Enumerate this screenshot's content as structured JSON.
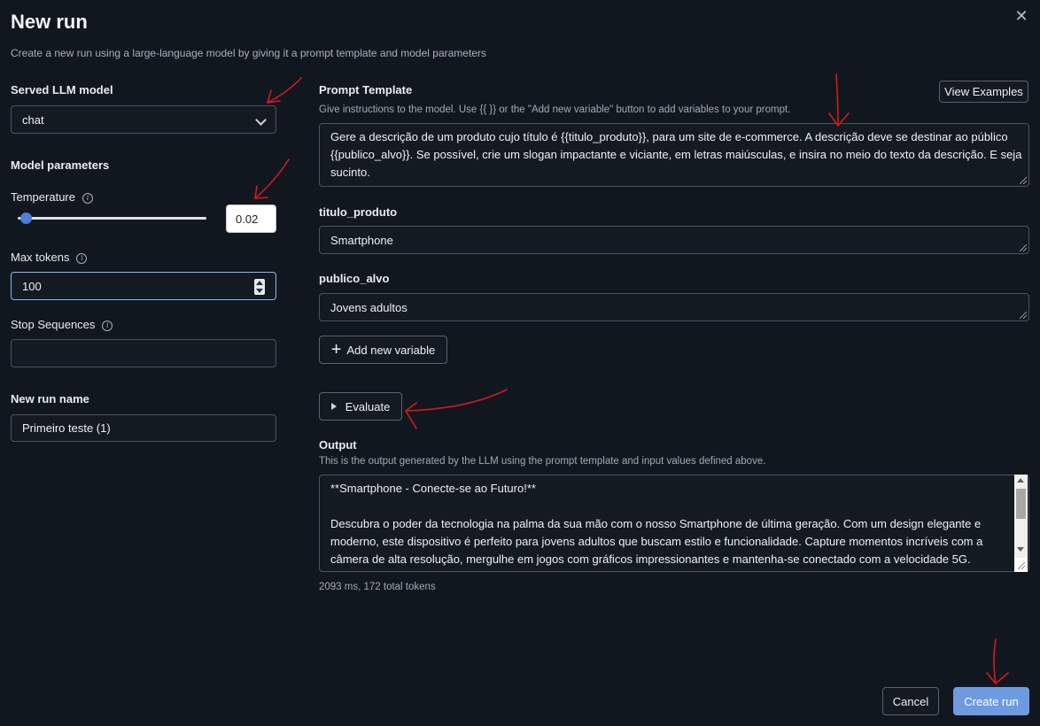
{
  "dialog": {
    "title": "New run",
    "subtitle": "Create a new run using a large-language model by giving it a prompt template and model parameters",
    "close_glyph": "✕"
  },
  "left": {
    "served_model_label": "Served LLM model",
    "served_model_value": "chat",
    "model_params_label": "Model parameters",
    "temperature_label": "Temperature",
    "temperature_value": "0.02",
    "temperature_fraction": 0.02,
    "max_tokens_label": "Max tokens",
    "max_tokens_value": "100",
    "stop_sequences_label": "Stop Sequences",
    "stop_sequences_value": "",
    "run_name_label": "New run name",
    "run_name_value": "Primeiro teste (1)",
    "info_glyph": "i"
  },
  "right": {
    "prompt_label": "Prompt Template",
    "prompt_hint": "Give instructions to the model. Use {{ }} or the \"Add new variable\" button to add variables to your prompt.",
    "view_examples": "View Examples",
    "prompt_lines": [
      "Gere a descrição de um produto cujo título é {{titulo_produto}}, para um site de e-commerce. A descrição deve se destinar ao público",
      "{{publico_alvo}}. Se possível, crie um slogan impactante e viciante, em letras maiúsculas, e insira no meio do texto da descrição. E seja",
      "sucinto."
    ],
    "var1_label": "titulo_produto",
    "var1_value": "Smartphone",
    "var2_label": "publico_alvo",
    "var2_value": "Jovens adultos",
    "add_variable": "Add new variable",
    "plus_glyph": "+",
    "evaluate": "Evaluate",
    "output_label": "Output",
    "output_hint": "This is the output generated by the LLM using the prompt template and input values defined above.",
    "output_lines": [
      "**Smartphone - Conecte-se ao Futuro!**",
      "",
      "Descubra o poder da tecnologia na palma da sua mão com o nosso Smartphone de última geração. Com um design elegante e",
      "moderno, este dispositivo é perfeito para jovens adultos que buscam estilo e funcionalidade. Capture momentos incríveis com a",
      "câmera de alta resolução, mergulhe em jogos com gráficos impressionantes e mantenha-se conectado com a velocidade 5G."
    ],
    "output_stats": "2093 ms, 172 total tokens"
  },
  "footer": {
    "cancel": "Cancel",
    "create": "Create run"
  },
  "colors": {
    "background": "#11171f",
    "primary_button": "#6e9be0",
    "slider_thumb": "#4d7fd6",
    "annotation_arrow": "#d9181c"
  }
}
